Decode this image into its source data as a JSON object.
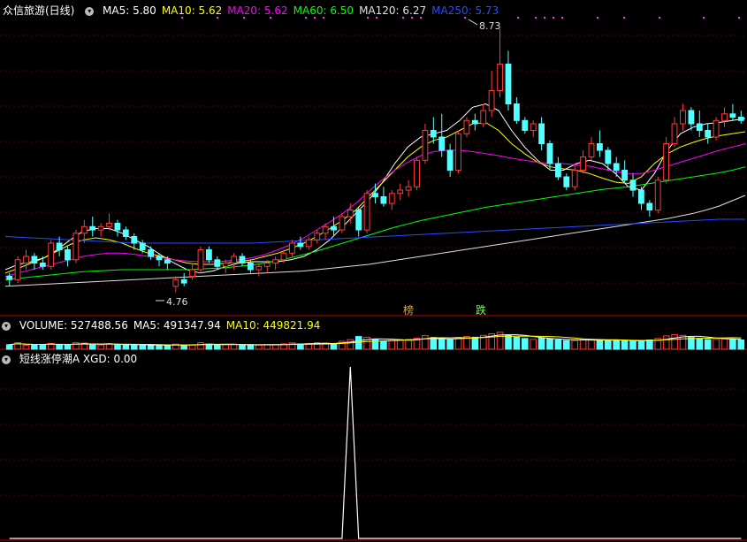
{
  "main_header": {
    "title": "众信旅游(日线)",
    "indicators": [
      {
        "label": "MA5: 5.80",
        "color": "#ffffff"
      },
      {
        "label": "MA10: 5.62",
        "color": "#ffff00"
      },
      {
        "label": "MA20: 5.62",
        "color": "#ff00ff"
      },
      {
        "label": "MA60: 6.50",
        "color": "#00ff00"
      },
      {
        "label": "MA120: 6.27",
        "color": "#e0e0e0"
      },
      {
        "label": "MA250: 5.73",
        "color": "#2a4bff"
      }
    ]
  },
  "volume_header": {
    "items": [
      {
        "label": "VOLUME: 527488.56",
        "color": "#ffffff"
      },
      {
        "label": "MA5: 491347.94",
        "color": "#ffffff"
      },
      {
        "label": "MA10: 449821.94",
        "color": "#ffff00"
      }
    ]
  },
  "indicator_header": {
    "items": [
      {
        "label": "短线涨停潮A XGD: 0.00",
        "color": "#ffffff"
      }
    ]
  },
  "annotations": {
    "high": "8.73",
    "low": "4.76",
    "marker_1": "榜",
    "marker_2": "跌"
  },
  "chart_data": [
    {
      "type": "candlestick",
      "title": "众信旅游(日线)",
      "ylim": [
        4.5,
        8.9
      ],
      "up_color": "#ff3a3a",
      "down_color": "#54ffff",
      "candles": [
        [
          5.0,
          5.05,
          4.85,
          4.95
        ],
        [
          4.95,
          5.3,
          4.9,
          5.25
        ],
        [
          5.2,
          5.4,
          5.1,
          5.3
        ],
        [
          5.3,
          5.35,
          5.1,
          5.2
        ],
        [
          5.2,
          5.3,
          5.1,
          5.15
        ],
        [
          5.15,
          5.55,
          5.1,
          5.5
        ],
        [
          5.5,
          5.6,
          5.3,
          5.4
        ],
        [
          5.4,
          5.45,
          5.15,
          5.25
        ],
        [
          5.25,
          5.7,
          5.2,
          5.65
        ],
        [
          5.65,
          5.85,
          5.5,
          5.75
        ],
        [
          5.75,
          5.9,
          5.6,
          5.7
        ],
        [
          5.7,
          5.8,
          5.6,
          5.75
        ],
        [
          5.75,
          5.95,
          5.7,
          5.8
        ],
        [
          5.8,
          5.85,
          5.6,
          5.7
        ],
        [
          5.7,
          5.75,
          5.55,
          5.6
        ],
        [
          5.6,
          5.65,
          5.4,
          5.5
        ],
        [
          5.5,
          5.55,
          5.35,
          5.4
        ],
        [
          5.4,
          5.45,
          5.25,
          5.3
        ],
        [
          5.3,
          5.35,
          5.15,
          5.25
        ],
        [
          5.25,
          5.3,
          5.1,
          5.2
        ],
        [
          4.85,
          5.0,
          4.76,
          4.95
        ],
        [
          4.95,
          5.05,
          4.85,
          4.9
        ],
        [
          5.0,
          5.2,
          4.95,
          5.1
        ],
        [
          5.1,
          5.45,
          5.05,
          5.4
        ],
        [
          5.4,
          5.45,
          5.2,
          5.25
        ],
        [
          5.25,
          5.3,
          5.1,
          5.15
        ],
        [
          5.15,
          5.25,
          5.05,
          5.2
        ],
        [
          5.2,
          5.35,
          5.1,
          5.3
        ],
        [
          5.3,
          5.35,
          5.15,
          5.2
        ],
        [
          5.2,
          5.25,
          5.05,
          5.1
        ],
        [
          5.1,
          5.2,
          5.0,
          5.15
        ],
        [
          5.15,
          5.25,
          5.05,
          5.2
        ],
        [
          5.2,
          5.3,
          5.1,
          5.25
        ],
        [
          5.25,
          5.4,
          5.2,
          5.35
        ],
        [
          5.35,
          5.55,
          5.3,
          5.5
        ],
        [
          5.5,
          5.6,
          5.4,
          5.45
        ],
        [
          5.45,
          5.6,
          5.4,
          5.55
        ],
        [
          5.55,
          5.7,
          5.5,
          5.65
        ],
        [
          5.65,
          5.8,
          5.55,
          5.75
        ],
        [
          5.75,
          5.9,
          5.6,
          5.7
        ],
        [
          5.7,
          5.95,
          5.65,
          5.9
        ],
        [
          5.9,
          6.1,
          5.8,
          6.0
        ],
        [
          6.0,
          6.05,
          5.6,
          5.7
        ],
        [
          5.7,
          6.3,
          5.65,
          6.25
        ],
        [
          6.25,
          6.4,
          6.1,
          6.2
        ],
        [
          6.2,
          6.35,
          6.05,
          6.1
        ],
        [
          6.1,
          6.3,
          6.0,
          6.25
        ],
        [
          6.25,
          6.4,
          6.15,
          6.3
        ],
        [
          6.3,
          6.45,
          6.2,
          6.35
        ],
        [
          6.35,
          6.8,
          6.3,
          6.75
        ],
        [
          6.75,
          7.3,
          6.7,
          7.2
        ],
        [
          7.2,
          7.4,
          7.0,
          7.1
        ],
        [
          7.1,
          7.45,
          6.8,
          6.9
        ],
        [
          6.9,
          7.0,
          6.5,
          6.6
        ],
        [
          6.6,
          7.2,
          6.55,
          7.15
        ],
        [
          7.15,
          7.4,
          7.1,
          7.35
        ],
        [
          7.35,
          7.45,
          7.2,
          7.3
        ],
        [
          7.3,
          7.6,
          7.25,
          7.5
        ],
        [
          7.5,
          8.1,
          7.4,
          7.8
        ],
        [
          7.8,
          8.73,
          7.7,
          8.2
        ],
        [
          8.2,
          8.4,
          7.5,
          7.6
        ],
        [
          7.6,
          7.7,
          7.3,
          7.35
        ],
        [
          7.35,
          7.4,
          7.15,
          7.2
        ],
        [
          7.2,
          7.35,
          7.1,
          7.3
        ],
        [
          7.3,
          7.4,
          6.9,
          7.0
        ],
        [
          7.0,
          7.05,
          6.6,
          6.7
        ],
        [
          6.7,
          6.8,
          6.45,
          6.5
        ],
        [
          6.5,
          6.55,
          6.3,
          6.35
        ],
        [
          6.35,
          6.7,
          6.3,
          6.6
        ],
        [
          6.6,
          6.9,
          6.55,
          6.8
        ],
        [
          6.8,
          7.1,
          6.75,
          7.0
        ],
        [
          7.0,
          7.2,
          6.8,
          6.9
        ],
        [
          6.9,
          6.95,
          6.6,
          6.7
        ],
        [
          6.7,
          6.8,
          6.5,
          6.6
        ],
        [
          6.6,
          6.75,
          6.4,
          6.45
        ],
        [
          6.45,
          6.55,
          6.2,
          6.3
        ],
        [
          6.3,
          6.35,
          6.0,
          6.1
        ],
        [
          6.1,
          6.15,
          5.9,
          6.0
        ],
        [
          6.0,
          6.5,
          5.95,
          6.45
        ],
        [
          6.45,
          7.1,
          6.4,
          7.0
        ],
        [
          7.0,
          7.4,
          6.95,
          7.3
        ],
        [
          7.3,
          7.6,
          7.2,
          7.5
        ],
        [
          7.5,
          7.55,
          7.2,
          7.3
        ],
        [
          7.3,
          7.5,
          7.1,
          7.2
        ],
        [
          7.2,
          7.3,
          7.0,
          7.1
        ],
        [
          7.1,
          7.4,
          7.05,
          7.35
        ],
        [
          7.35,
          7.55,
          7.25,
          7.45
        ],
        [
          7.45,
          7.6,
          7.35,
          7.4
        ],
        [
          7.4,
          7.5,
          7.3,
          7.35
        ]
      ],
      "ma_series": [
        {
          "name": "MA5",
          "color": "#ffffff",
          "values": [
            5.1,
            5.18,
            5.22,
            5.28,
            5.4,
            5.55,
            5.68,
            5.72,
            5.72,
            5.65,
            5.55,
            5.45,
            5.32,
            5.2,
            5.1,
            5.05,
            5.08,
            5.15,
            5.2,
            5.22,
            5.22,
            5.22,
            5.25,
            5.3,
            5.4,
            5.55,
            5.75,
            5.95,
            6.15,
            6.4,
            6.7,
            6.95,
            7.1,
            7.15,
            7.2,
            7.35,
            7.55,
            7.6,
            7.5,
            7.2,
            6.95,
            6.75,
            6.6,
            6.6,
            6.7,
            6.75,
            6.7,
            6.55,
            6.35,
            6.3,
            6.55,
            6.9,
            7.15,
            7.25,
            7.3,
            7.32,
            7.35,
            7.38
          ]
        },
        {
          "name": "MA10",
          "color": "#ffff00",
          "values": [
            5.05,
            5.12,
            5.2,
            5.28,
            5.38,
            5.48,
            5.55,
            5.58,
            5.55,
            5.5,
            5.42,
            5.35,
            5.3,
            5.25,
            5.2,
            5.18,
            5.18,
            5.2,
            5.22,
            5.25,
            5.3,
            5.35,
            5.42,
            5.5,
            5.6,
            5.72,
            5.85,
            6.0,
            6.2,
            6.4,
            6.6,
            6.8,
            6.95,
            7.05,
            7.1,
            7.2,
            7.3,
            7.32,
            7.2,
            7.0,
            6.85,
            6.72,
            6.65,
            6.62,
            6.6,
            6.55,
            6.48,
            6.42,
            6.4,
            6.5,
            6.7,
            6.85,
            6.95,
            7.02,
            7.08,
            7.12,
            7.15,
            7.18
          ]
        },
        {
          "name": "MA20",
          "color": "#ff00ff",
          "values": [
            5.0,
            5.05,
            5.1,
            5.15,
            5.2,
            5.25,
            5.3,
            5.33,
            5.35,
            5.35,
            5.33,
            5.3,
            5.28,
            5.25,
            5.23,
            5.22,
            5.22,
            5.23,
            5.25,
            5.28,
            5.33,
            5.4,
            5.48,
            5.58,
            5.7,
            5.82,
            5.95,
            6.1,
            6.28,
            6.45,
            6.6,
            6.72,
            6.82,
            6.88,
            6.9,
            6.9,
            6.88,
            6.85,
            6.82,
            6.78,
            6.75,
            6.72,
            6.7,
            6.7,
            6.68,
            6.66,
            6.62,
            6.58,
            6.55,
            6.55,
            6.6,
            6.66,
            6.72,
            6.78,
            6.84,
            6.9,
            6.95,
            7.0
          ]
        },
        {
          "name": "MA60",
          "color": "#00ff00",
          "values": [
            4.95,
            4.97,
            4.99,
            5.01,
            5.03,
            5.05,
            5.07,
            5.08,
            5.09,
            5.1,
            5.1,
            5.1,
            5.1,
            5.1,
            5.1,
            5.11,
            5.12,
            5.13,
            5.15,
            5.17,
            5.2,
            5.24,
            5.28,
            5.33,
            5.38,
            5.44,
            5.5,
            5.56,
            5.62,
            5.68,
            5.74,
            5.79,
            5.84,
            5.88,
            5.92,
            5.96,
            6.0,
            6.04,
            6.07,
            6.1,
            6.13,
            6.16,
            6.19,
            6.22,
            6.25,
            6.28,
            6.31,
            6.33,
            6.35,
            6.38,
            6.41,
            6.44,
            6.47,
            6.5,
            6.53,
            6.56,
            6.6,
            6.65
          ]
        },
        {
          "name": "MA120",
          "color": "#e0e0e0",
          "values": [
            4.85,
            4.86,
            4.87,
            4.88,
            4.89,
            4.9,
            4.91,
            4.92,
            4.93,
            4.94,
            4.95,
            4.96,
            4.97,
            4.98,
            4.99,
            5.0,
            5.01,
            5.02,
            5.03,
            5.04,
            5.05,
            5.06,
            5.07,
            5.08,
            5.1,
            5.12,
            5.14,
            5.16,
            5.18,
            5.21,
            5.24,
            5.27,
            5.3,
            5.33,
            5.36,
            5.39,
            5.42,
            5.45,
            5.48,
            5.51,
            5.54,
            5.57,
            5.6,
            5.63,
            5.66,
            5.69,
            5.72,
            5.75,
            5.78,
            5.81,
            5.84,
            5.87,
            5.91,
            5.95,
            6.0,
            6.06,
            6.14,
            6.22
          ]
        },
        {
          "name": "MA250",
          "color": "#2a4bff",
          "values": [
            5.6,
            5.59,
            5.58,
            5.57,
            5.56,
            5.55,
            5.54,
            5.53,
            5.52,
            5.51,
            5.5,
            5.5,
            5.5,
            5.5,
            5.5,
            5.5,
            5.5,
            5.5,
            5.5,
            5.5,
            5.51,
            5.52,
            5.53,
            5.54,
            5.55,
            5.56,
            5.57,
            5.58,
            5.59,
            5.6,
            5.61,
            5.62,
            5.63,
            5.64,
            5.65,
            5.66,
            5.67,
            5.68,
            5.69,
            5.7,
            5.71,
            5.72,
            5.73,
            5.74,
            5.75,
            5.76,
            5.77,
            5.78,
            5.79,
            5.8,
            5.81,
            5.82,
            5.83,
            5.84,
            5.85,
            5.86,
            5.86,
            5.86
          ]
        }
      ]
    },
    {
      "type": "bar",
      "title": "VOLUME: 527488.56",
      "ylim": [
        0,
        1200000
      ],
      "values": [
        300000,
        420000,
        260000,
        280000,
        300000,
        380000,
        310000,
        260000,
        420000,
        400000,
        320000,
        280000,
        350000,
        300000,
        260000,
        300000,
        270000,
        250000,
        260000,
        240000,
        330000,
        260000,
        300000,
        420000,
        330000,
        280000,
        290000,
        320000,
        300000,
        250000,
        270000,
        300000,
        310000,
        350000,
        410000,
        330000,
        360000,
        420000,
        400000,
        360000,
        520000,
        620000,
        820000,
        780000,
        600000,
        500000,
        560000,
        620000,
        640000,
        720000,
        880000,
        760000,
        720000,
        620000,
        760000,
        820000,
        780000,
        900000,
        1000000,
        1100000,
        920000,
        780000,
        700000,
        640000,
        720000,
        660000,
        600000,
        560000,
        560000,
        620000,
        640000,
        600000,
        560000,
        580000,
        540000,
        520000,
        520000,
        600000,
        700000,
        860000,
        940000,
        900000,
        760000,
        700000,
        620000,
        640000,
        680000,
        660000,
        600000
      ]
    },
    {
      "type": "line",
      "title": "短线涨停潮A XGD: 0.00",
      "ylim": [
        0,
        1
      ],
      "values": [
        0,
        0,
        0,
        0,
        0,
        0,
        0,
        0,
        0,
        0,
        0,
        0,
        0,
        0,
        0,
        0,
        0,
        0,
        0,
        0,
        0,
        0,
        0,
        0,
        0,
        0,
        0,
        0,
        0,
        0,
        0,
        0,
        0,
        0,
        0,
        0,
        0,
        0,
        0,
        0,
        0,
        1,
        0,
        0,
        0,
        0,
        0,
        0,
        0,
        0,
        0,
        0,
        0,
        0,
        0,
        0,
        0,
        0,
        0,
        0,
        0,
        0,
        0,
        0,
        0,
        0,
        0,
        0,
        0,
        0,
        0,
        0,
        0,
        0,
        0,
        0,
        0,
        0,
        0,
        0,
        0,
        0,
        0,
        0,
        0,
        0,
        0,
        0,
        0
      ]
    }
  ]
}
